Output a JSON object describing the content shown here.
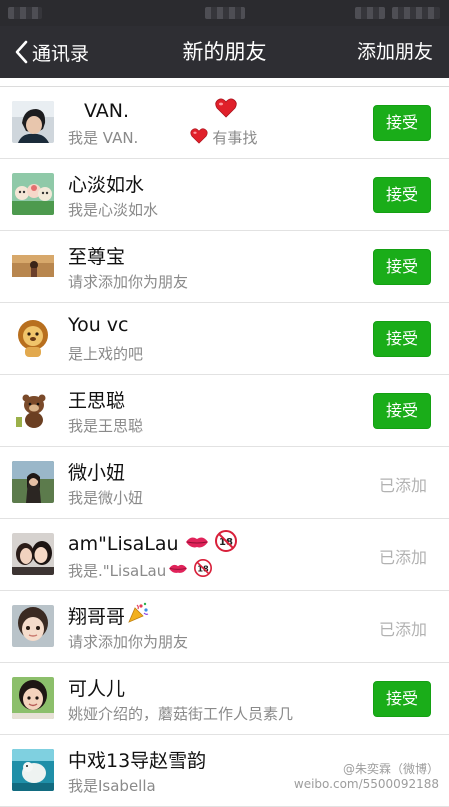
{
  "status_bar": {},
  "nav": {
    "back_label": "通讯录",
    "title": "新的朋友",
    "right_label": "添加朋友"
  },
  "contacts": [
    {
      "name": "VAN.",
      "sub": "我是  VAN.",
      "sub_suffix": "有事找",
      "action": "接受"
    },
    {
      "name": "心淡如水",
      "sub": "我是心淡如水",
      "action": "接受"
    },
    {
      "name": "至尊宝",
      "sub": "请求添加你为朋友",
      "action": "接受"
    },
    {
      "name": "You  vc",
      "sub": "是上戏的吧",
      "action": "接受"
    },
    {
      "name": "王思聪",
      "sub": "我是王思聪",
      "action": "接受"
    },
    {
      "name": "微小妞",
      "sub": "我是微小妞",
      "action": "已添加"
    },
    {
      "name": "am\"LisaLau",
      "sub": "我是.\"LisaLau",
      "action": "已添加"
    },
    {
      "name": "翔哥哥",
      "sub": "请求添加你为朋友",
      "action": "已添加"
    },
    {
      "name": "可人儿",
      "sub": "姚娅介绍的，蘑菇街工作人员素几",
      "action": "接受"
    },
    {
      "name": "中戏13导赵雪韵",
      "sub": "我是Isabella",
      "action": ""
    }
  ],
  "watermark": {
    "line1": "@朱奕霖（微博）",
    "line2": "weibo.com/5500092188"
  },
  "colors": {
    "accept_green": "#1aad19",
    "navbar": "#2e2e33",
    "added_gray": "#b2b2b2"
  }
}
